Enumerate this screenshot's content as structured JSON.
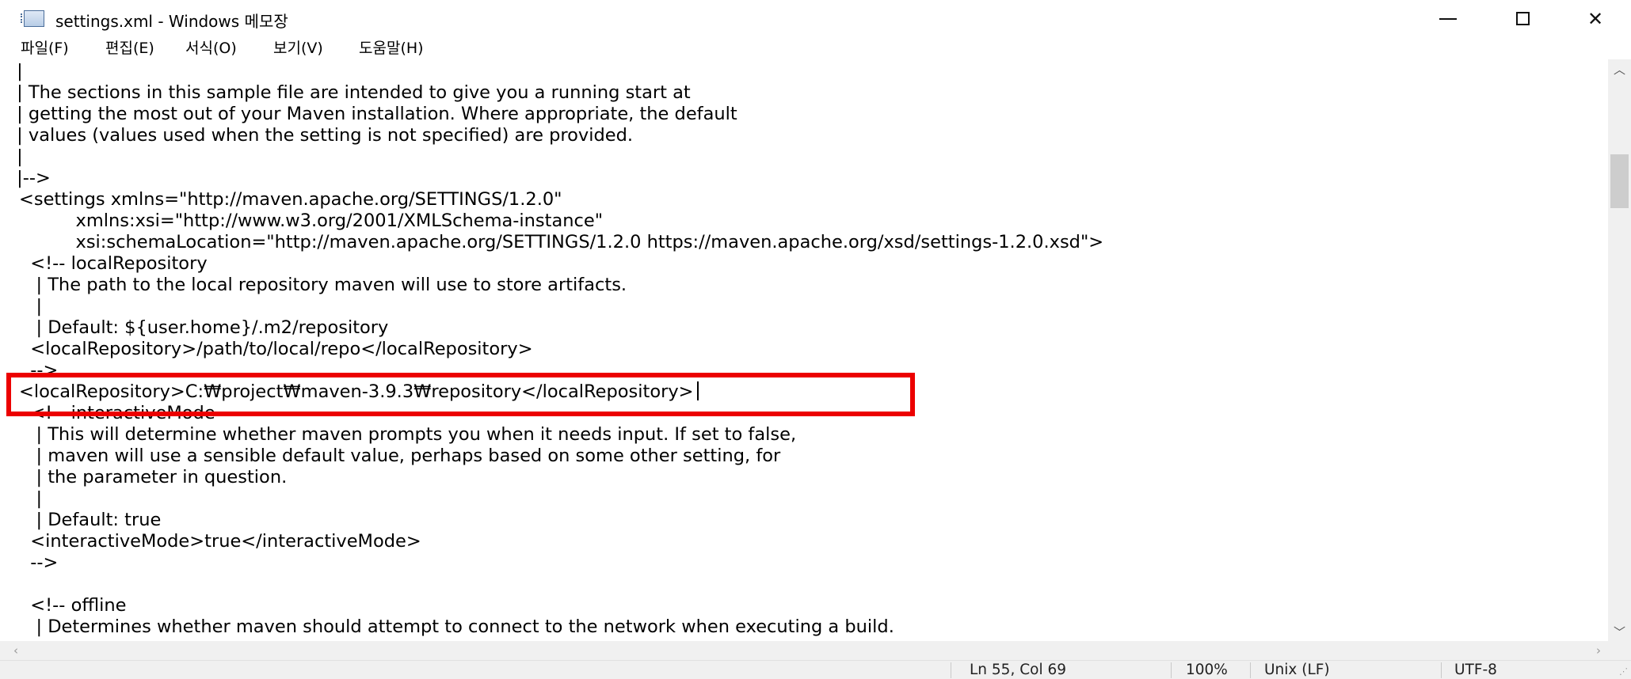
{
  "window": {
    "title": "settings.xml - Windows 메모장",
    "minimize_icon": "minimize-icon",
    "maximize_icon": "maximize-icon",
    "close_icon": "close-icon",
    "close_glyph": "✕"
  },
  "menu": {
    "items": [
      "파일(F)",
      "편집(E)",
      "서식(O)",
      "보기(V)",
      "도움말(H)"
    ]
  },
  "editor": {
    "lines": [
      " |",
      " | The sections in this sample file are intended to give you a running start at",
      " | getting the most out of your Maven installation. Where appropriate, the default",
      " | values (values used when the setting is not specified) are provided.",
      " |",
      " |-->",
      "<settings xmlns=\"http://maven.apache.org/SETTINGS/1.2.0\"",
      "          xmlns:xsi=\"http://www.w3.org/2001/XMLSchema-instance\"",
      "          xsi:schemaLocation=\"http://maven.apache.org/SETTINGS/1.2.0 https://maven.apache.org/xsd/settings-1.2.0.xsd\">",
      "  <!-- localRepository",
      "   | The path to the local repository maven will use to store artifacts.",
      "   |",
      "   | Default: ${user.home}/.m2/repository",
      "  <localRepository>/path/to/local/repo</localRepository>",
      "  -->",
      "<localRepository>C:₩project₩maven-3.9.3₩repository</localRepository>",
      "  <!-- interactiveMode",
      "   | This will determine whether maven prompts you when it needs input. If set to false,",
      "   | maven will use a sensible default value, perhaps based on some other setting, for",
      "   | the parameter in question.",
      "   |",
      "   | Default: true",
      "  <interactiveMode>true</interactiveMode>",
      "  -->",
      "",
      "  <!-- offline",
      "   | Determines whether maven should attempt to connect to the network when executing a build."
    ],
    "highlight_color": "#ec0000"
  },
  "status": {
    "position": "Ln 55, Col 69",
    "zoom": "100%",
    "line_ending": "Unix (LF)",
    "encoding": "UTF-8"
  },
  "scrollbars": {
    "up_arrow": "chevron-up-icon",
    "down_arrow": "chevron-down-icon",
    "up_glyph": "︿",
    "down_glyph": "﹀",
    "left_glyph": "‹",
    "right_glyph": "›"
  }
}
